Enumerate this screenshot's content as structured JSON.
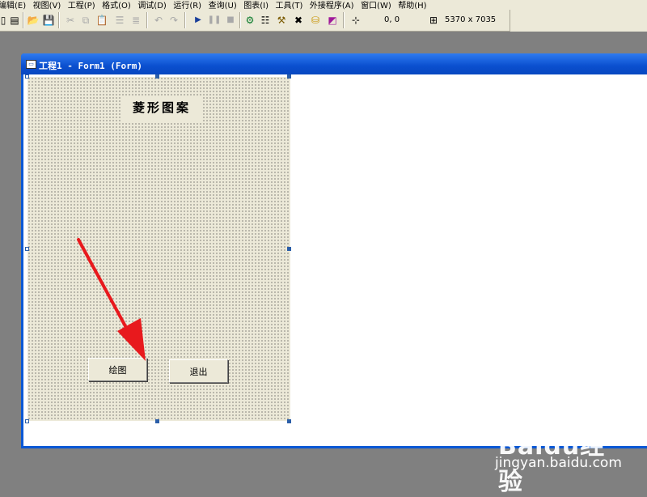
{
  "menu": [
    "编辑(E)",
    "视图(V)",
    "工程(P)",
    "格式(O)",
    "调试(D)",
    "运行(R)",
    "查询(U)",
    "图表(I)",
    "工具(T)",
    "外接程序(A)",
    "窗口(W)",
    "帮助(H)"
  ],
  "toolbar": {
    "position_readout": "0, 0",
    "size_readout": "5370 x 7035"
  },
  "window": {
    "title": "工程1 - Form1 (Form)"
  },
  "form": {
    "label_text": "菱形图案",
    "draw_button": "绘图",
    "exit_button": "退出"
  },
  "watermark": {
    "logo": "Baidu经验",
    "url": "jingyan.baidu.com"
  },
  "colors": {
    "titlebar": "#0a58d6",
    "form_bg": "#ece9d8",
    "arrow": "#e8191d"
  }
}
